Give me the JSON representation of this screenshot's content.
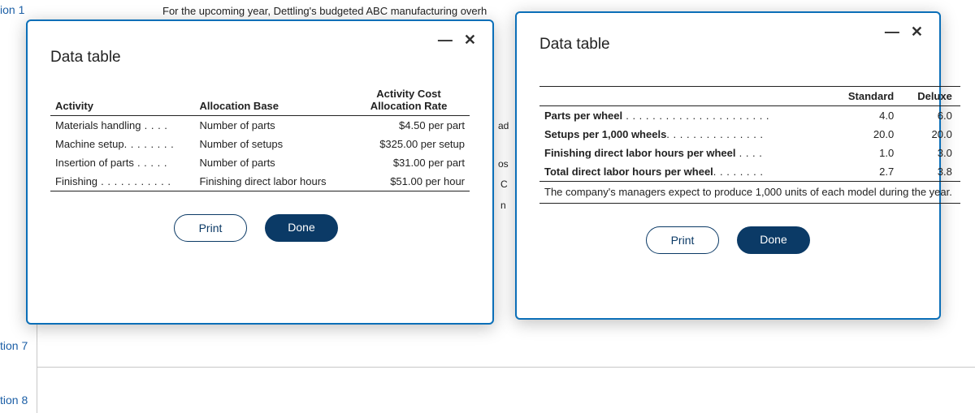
{
  "background": {
    "intro": "For the upcoming year, Dettling's budgeted ABC manufacturing overh"
  },
  "sidebar": {
    "q1": "ion 1",
    "q7": "tion 7",
    "q8": "tion 8"
  },
  "peek": {
    "c1": "ad",
    "c2": "os",
    "c3": "C",
    "c4": "n"
  },
  "modal_left": {
    "title": "Data table",
    "headers": {
      "activity": "Activity",
      "base": "Allocation Base",
      "rate": "Activity Cost Allocation Rate"
    },
    "rows": [
      {
        "activity": "Materials handling",
        "dots": " . . . .",
        "base": "Number of parts",
        "rate": "$4.50 per part"
      },
      {
        "activity": "Machine setup",
        "dots": ". . . . . . . .",
        "base": "Number of setups",
        "rate": "$325.00 per setup"
      },
      {
        "activity": "Insertion of parts",
        "dots": " . . . . .",
        "base": "Number of parts",
        "rate": "$31.00 per part"
      },
      {
        "activity": "Finishing",
        "dots": " . . . . . . . . . . .",
        "base": "Finishing direct labor hours",
        "rate": "$51.00 per hour"
      }
    ],
    "buttons": {
      "print": "Print",
      "done": "Done"
    }
  },
  "modal_right": {
    "title": "Data table",
    "headers": {
      "std": "Standard",
      "dlx": "Deluxe"
    },
    "rows": [
      {
        "label": "Parts per wheel",
        "dots": " . . . . . . . . . . . . . . . . . . . . . .",
        "std": "4.0",
        "dlx": "6.0"
      },
      {
        "label": "Setups per 1,000 wheels",
        "dots": ". . . . . . . . . . . . . . .",
        "std": "20.0",
        "dlx": "20.0"
      },
      {
        "label": "Finishing direct labor hours per wheel",
        "dots": " . . . .",
        "std": "1.0",
        "dlx": "3.0"
      },
      {
        "label": "Total direct labor hours per wheel",
        "dots": ". . . . . . . .",
        "std": "2.7",
        "dlx": "3.8"
      }
    ],
    "note": "The company's managers expect to produce 1,000 units of each model during the year.",
    "buttons": {
      "print": "Print",
      "done": "Done"
    }
  },
  "chart_data": [
    {
      "type": "table",
      "title": "Activity Cost Allocation Rates",
      "columns": [
        "Activity",
        "Allocation Base",
        "Activity Cost Allocation Rate"
      ],
      "rows": [
        [
          "Materials handling",
          "Number of parts",
          "$4.50 per part"
        ],
        [
          "Machine setup",
          "Number of setups",
          "$325.00 per setup"
        ],
        [
          "Insertion of parts",
          "Number of parts",
          "$31.00 per part"
        ],
        [
          "Finishing",
          "Finishing direct labor hours",
          "$51.00 per hour"
        ]
      ]
    },
    {
      "type": "table",
      "title": "Production parameters per model",
      "columns": [
        "",
        "Standard",
        "Deluxe"
      ],
      "rows": [
        [
          "Parts per wheel",
          4.0,
          6.0
        ],
        [
          "Setups per 1,000 wheels",
          20.0,
          20.0
        ],
        [
          "Finishing direct labor hours per wheel",
          1.0,
          3.0
        ],
        [
          "Total direct labor hours per wheel",
          2.7,
          3.8
        ]
      ],
      "note": "The company's managers expect to produce 1,000 units of each model during the year."
    }
  ]
}
